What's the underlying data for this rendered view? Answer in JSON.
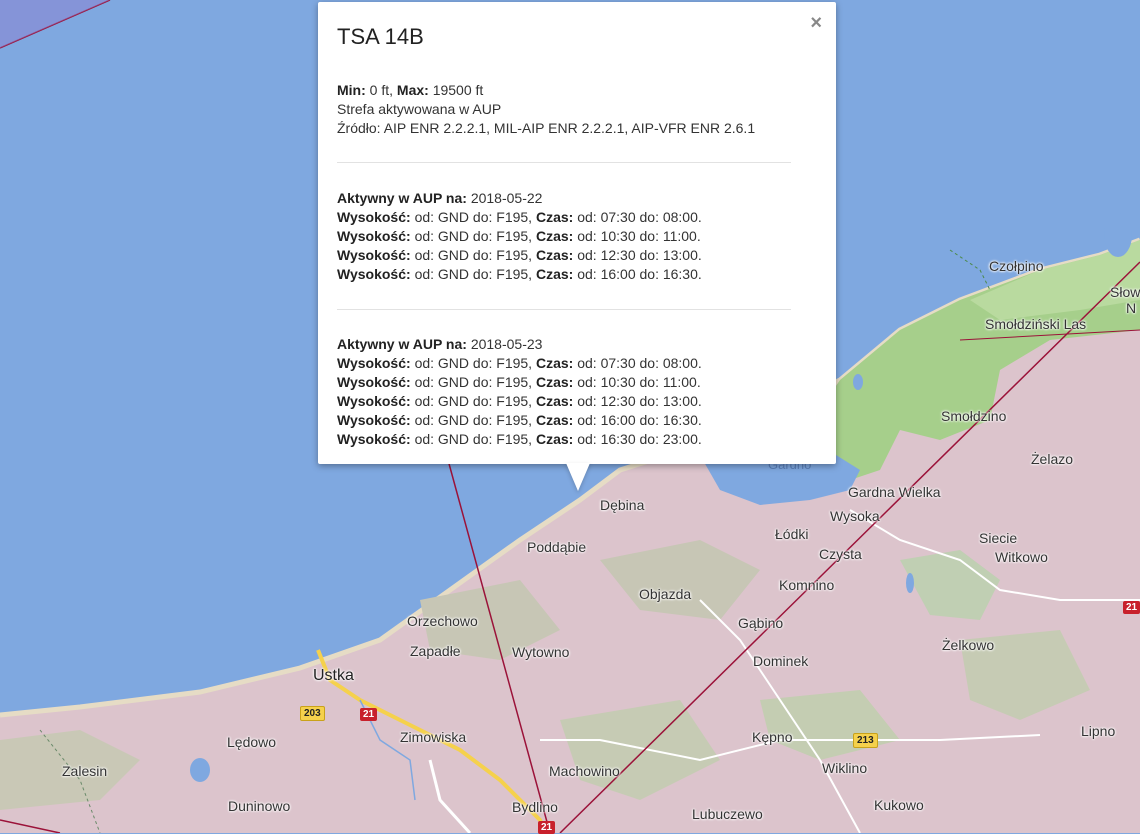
{
  "popup": {
    "title": "TSA 14B",
    "close_glyph": "×",
    "min_label": "Min:",
    "min_value": "0 ft,",
    "max_label": "Max:",
    "max_value": "19500 ft",
    "note": "Strefa aktywowana w AUP",
    "source": "Źródło: AIP ENR 2.2.2.1, MIL-AIP ENR 2.2.2.1, AIP-VFR ENR 2.6.1",
    "active_label": "Aktywny w AUP na:",
    "alt_label": "Wysokość:",
    "time_label": "Czas:",
    "days": [
      {
        "date": "2018-05-22",
        "entries": [
          {
            "alt": "od: GND do: F195,",
            "time": "od: 07:30 do: 08:00."
          },
          {
            "alt": "od: GND do: F195,",
            "time": "od: 10:30 do: 11:00."
          },
          {
            "alt": "od: GND do: F195,",
            "time": "od: 12:30 do: 13:00."
          },
          {
            "alt": "od: GND do: F195,",
            "time": "od: 16:00 do: 16:30."
          }
        ]
      },
      {
        "date": "2018-05-23",
        "entries": [
          {
            "alt": "od: GND do: F195,",
            "time": "od: 07:30 do: 08:00."
          },
          {
            "alt": "od: GND do: F195,",
            "time": "od: 10:30 do: 11:00."
          },
          {
            "alt": "od: GND do: F195,",
            "time": "od: 12:30 do: 13:00."
          },
          {
            "alt": "od: GND do: F195,",
            "time": "od: 16:00 do: 16:30."
          },
          {
            "alt": "od: GND do: F195,",
            "time": "od: 16:30 do: 23:00."
          }
        ]
      }
    ]
  },
  "places": {
    "czolpino": "Czołpino",
    "slow": "Słow",
    "slow2": "N",
    "smoldzinski_las": "Smołdziński Las",
    "smoldzino": "Smołdzino",
    "zelazo": "Żelazo",
    "gardno": "Gardno",
    "gardna_wielka": "Gardna Wielka",
    "debina": "Dębina",
    "wysoka": "Wysoka",
    "lodki": "Łódki",
    "siecie": "Siecie",
    "witkowo": "Witkowo",
    "czysta": "Czysta",
    "poddabie": "Poddąbie",
    "komnino": "Komnino",
    "objazda": "Objazda",
    "orzechowo": "Orzechowo",
    "gabino": "Gąbino",
    "zelkowo": "Żelkowo",
    "zapadle": "Zapadłe",
    "wytowno": "Wytowno",
    "dominek": "Dominek",
    "ustka": "Ustka",
    "ledowo": "Lędowo",
    "zimowiska": "Zimowiska",
    "kepno": "Kępno",
    "lipno": "Lipno",
    "zalesin": "Zalesin",
    "machowino": "Machowino",
    "wiklino": "Wiklino",
    "duninowo": "Duninowo",
    "bydlino": "Bydlino",
    "kukowo": "Kukowo",
    "lubuczewo": "Lubuczewo"
  },
  "roads": {
    "r203": "203",
    "r21a": "21",
    "r21b": "21",
    "r213": "213",
    "r21c": "21"
  },
  "colors": {
    "sea": "#7fa8e0",
    "land_pink": "#dcc4cc",
    "forest": "#a6cf8b",
    "airspace_line": "#9b1239",
    "coast_beach": "#e6dcc5"
  }
}
